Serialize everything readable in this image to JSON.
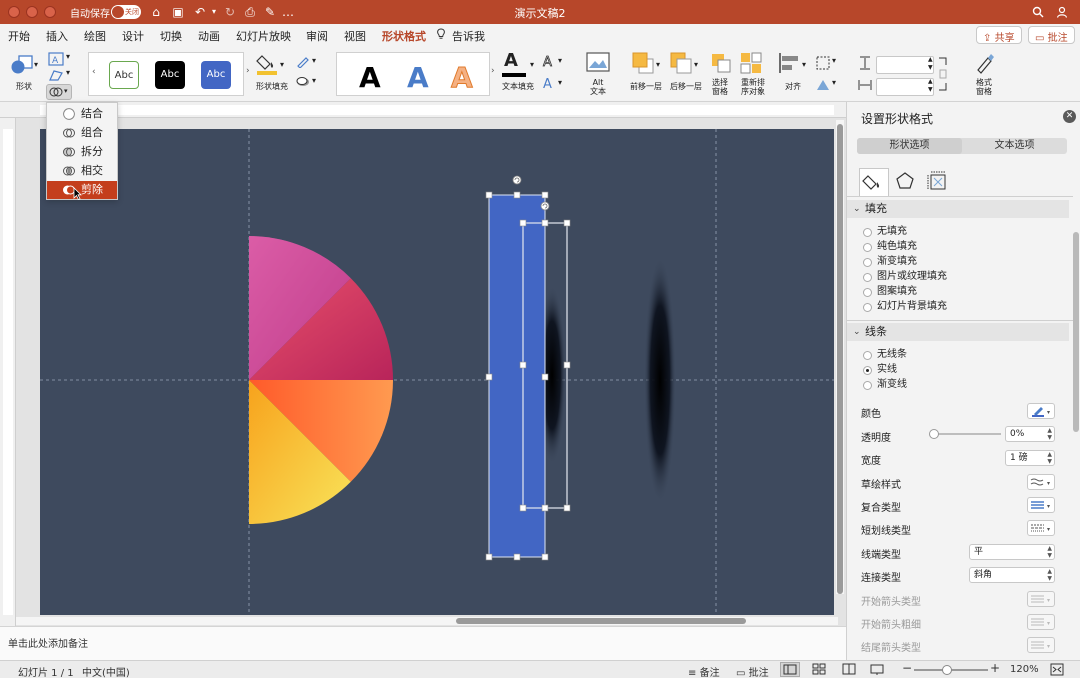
{
  "titlebar": {
    "autosave_label": "自动保存",
    "autosave_state": "关闭",
    "doc_title": "演示文稿2"
  },
  "tabs": [
    {
      "label": "开始"
    },
    {
      "label": "插入"
    },
    {
      "label": "绘图"
    },
    {
      "label": "设计"
    },
    {
      "label": "切换"
    },
    {
      "label": "动画"
    },
    {
      "label": "幻灯片放映"
    },
    {
      "label": "审阅"
    },
    {
      "label": "视图"
    },
    {
      "label": "形状格式",
      "active": true
    },
    {
      "label": "告诉我"
    }
  ],
  "header_actions": {
    "share": "共享",
    "comment": "批注"
  },
  "ribbon": {
    "shapes_label": "形状",
    "style_samples": [
      "Abc",
      "Abc",
      "Abc"
    ],
    "shape_fill_label": "形状填充",
    "wordart_letter": "A",
    "text_fill_label": "文本填充",
    "alt_text_label": "Alt\n文本",
    "bring_forward": "前移一层",
    "send_backward": "后移一层",
    "selection_pane": "选择\n窗格",
    "reorder": "重新排\n序对象",
    "align": "对齐",
    "format_pane": "格式\n窗格",
    "height_value": "",
    "width_value": ""
  },
  "merge_menu": {
    "items": [
      {
        "label": "结合"
      },
      {
        "label": "组合"
      },
      {
        "label": "拆分"
      },
      {
        "label": "相交"
      },
      {
        "label": "剪除",
        "selected": true
      }
    ]
  },
  "notes": {
    "placeholder": "单击此处添加备注"
  },
  "statusbar": {
    "slide_info": "幻灯片 1 / 1",
    "language": "中文(中国)",
    "notes": "备注",
    "comments": "批注",
    "zoom": "120%"
  },
  "pane": {
    "title": "设置形状格式",
    "tab_shape": "形状选项",
    "tab_text": "文本选项",
    "fill": {
      "header": "填充",
      "options": [
        {
          "label": "无填充",
          "selected": false
        },
        {
          "label": "纯色填充",
          "selected": false
        },
        {
          "label": "渐变填充",
          "selected": false
        },
        {
          "label": "图片或纹理填充",
          "selected": false
        },
        {
          "label": "图案填充",
          "selected": false
        },
        {
          "label": "幻灯片背景填充",
          "selected": false
        }
      ]
    },
    "line": {
      "header": "线条",
      "options": [
        {
          "label": "无线条",
          "selected": false
        },
        {
          "label": "实线",
          "selected": true
        },
        {
          "label": "渐变线",
          "selected": false
        }
      ],
      "color_label": "颜色",
      "transparency_label": "透明度",
      "transparency_value": "0%",
      "width_label": "宽度",
      "width_value": "1 磅",
      "sketch_label": "草绘样式",
      "compound_label": "复合类型",
      "dash_label": "短划线类型",
      "cap_label": "线端类型",
      "cap_value": "平",
      "join_label": "连接类型",
      "join_value": "斜角",
      "begin_arrow_type": "开始箭头类型",
      "begin_arrow_size": "开始箭头粗细",
      "end_arrow_type": "结尾箭头类型"
    }
  },
  "colors": {
    "accent": "#b7472a",
    "slide_bg": "#3e4a5e",
    "rect_fill": "#4266c4"
  }
}
